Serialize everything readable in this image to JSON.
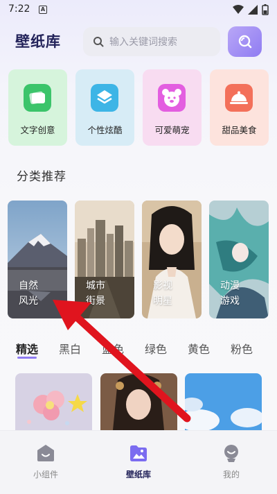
{
  "status": {
    "time": "7:22",
    "a_badge": "A"
  },
  "header": {
    "logo": "壁纸库",
    "search_placeholder": "输入关键词搜索"
  },
  "categories": [
    {
      "label": "文字创意",
      "icon": "text-card-icon",
      "bg": "#d6f4dc"
    },
    {
      "label": "个性炫酷",
      "icon": "layers-icon",
      "bg": "#d7ecf6"
    },
    {
      "label": "可爱萌宠",
      "icon": "bear-icon",
      "bg": "#f8dcf1"
    },
    {
      "label": "甜品美食",
      "icon": "food-cloche-icon",
      "bg": "#fde3dd"
    }
  ],
  "section": {
    "title": "分类推荐"
  },
  "recommend": [
    {
      "line1": "自然",
      "line2": "风光"
    },
    {
      "line1": "城市",
      "line2": "街景"
    },
    {
      "line1": "影视",
      "line2": "明星"
    },
    {
      "line1": "动漫",
      "line2": "游戏"
    }
  ],
  "tabs": [
    "精选",
    "黑白",
    "蓝色",
    "绿色",
    "黄色",
    "粉色"
  ],
  "active_tab": "精选",
  "bottom_nav": [
    {
      "label": "小组件",
      "icon": "widget-face-icon"
    },
    {
      "label": "壁纸库",
      "icon": "image-folder-icon",
      "active": true
    },
    {
      "label": "我的",
      "icon": "profile-icon"
    }
  ],
  "colors": {
    "accent": "#8f7cf2",
    "arrow": "#e0141e",
    "logo": "#23235a"
  }
}
